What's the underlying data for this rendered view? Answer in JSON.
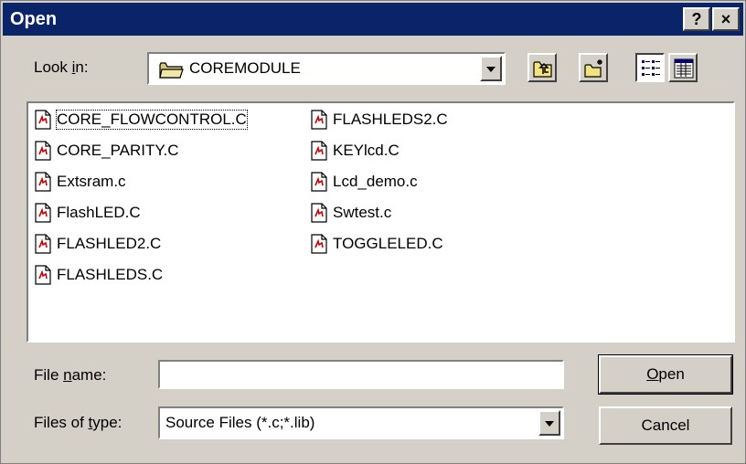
{
  "window": {
    "title": "Open",
    "help_glyph": "?",
    "close_glyph": "×"
  },
  "look_in": {
    "label_pre": "Look ",
    "label_key": "i",
    "label_post": "n:",
    "value": "COREMODULE",
    "icon": "folder-icon"
  },
  "toolbar": {
    "up_icon": "up-one-level-icon",
    "new_folder_icon": "new-folder-icon",
    "list_icon": "list-view-icon",
    "details_icon": "details-view-icon",
    "active_view": "list"
  },
  "files": {
    "column1": [
      "CORE_FLOWCONTROL.C",
      "CORE_PARITY.C",
      "Extsram.c",
      "FlashLED.C",
      "FLASHLED2.C",
      "FLASHLEDS.C"
    ],
    "column2": [
      "FLASHLEDS2.C",
      "KEYlcd.C",
      "Lcd_demo.c",
      "Swtest.c",
      "TOGGLELED.C"
    ],
    "icon": "c-source-file-icon"
  },
  "file_name": {
    "label_pre": "File ",
    "label_key": "n",
    "label_post": "ame:",
    "value": ""
  },
  "file_type": {
    "label_pre": "Files of ",
    "label_key": "t",
    "label_post": "ype:",
    "value": "Source Files (*.c;*.lib)"
  },
  "buttons": {
    "open_key": "O",
    "open_rest": "pen",
    "cancel": "Cancel"
  },
  "colors": {
    "title_bar": "#0a246a",
    "face": "#d4d0c8",
    "window": "#ffffff"
  }
}
